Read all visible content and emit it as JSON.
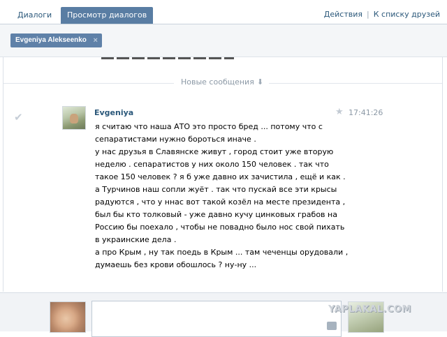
{
  "tabs": {
    "dialogs": "Диалоги",
    "view": "Просмотр диалогов",
    "actions": "Действия",
    "separator": "|",
    "back_to_friends": "К списку друзей"
  },
  "participants": {
    "chip": "Evgeniya Alekseenko",
    "remove_icon": "×"
  },
  "history": {
    "new_messages_label": "Новые сообщения",
    "new_messages_arrow": "⬇"
  },
  "message": {
    "author": "Evgeniya",
    "time": "17:41:26",
    "lines": [
      "я считаю что наша АТО это просто бред ... потому что с",
      "сепаратистами нужно бороться иначе .",
      "у нас друзья в Славянске живут , город стоит уже вторую",
      "неделю . сепаратистов у них около 150 человек . так что",
      "такое 150 человек ? я б уже давно их зачистила , ещё и как .",
      "а Турчинов наш сопли жуёт . так что пускай все эти крысы",
      "радуются , что у ннас вот такой козёл на месте президента ,",
      "был бы кто толковый - уже давно кучу цинковых грабов на",
      "Россию бы поехало , чтобы не повадно было нос свой пихать",
      "в украинские дела .",
      "а про Крым , ну так поедь в Крым ... там чеченцы орудовали ,",
      "думаешь без крови обошлось ? ну-ну ..."
    ]
  },
  "watermark": "YAPLAKAL.COM",
  "colors": {
    "link": "#2b587a",
    "active_tab": "#597da3",
    "chip": "#5f81a8"
  },
  "icons": {
    "read_check": "check-icon",
    "star": "star-icon",
    "camera": "camera-icon"
  }
}
